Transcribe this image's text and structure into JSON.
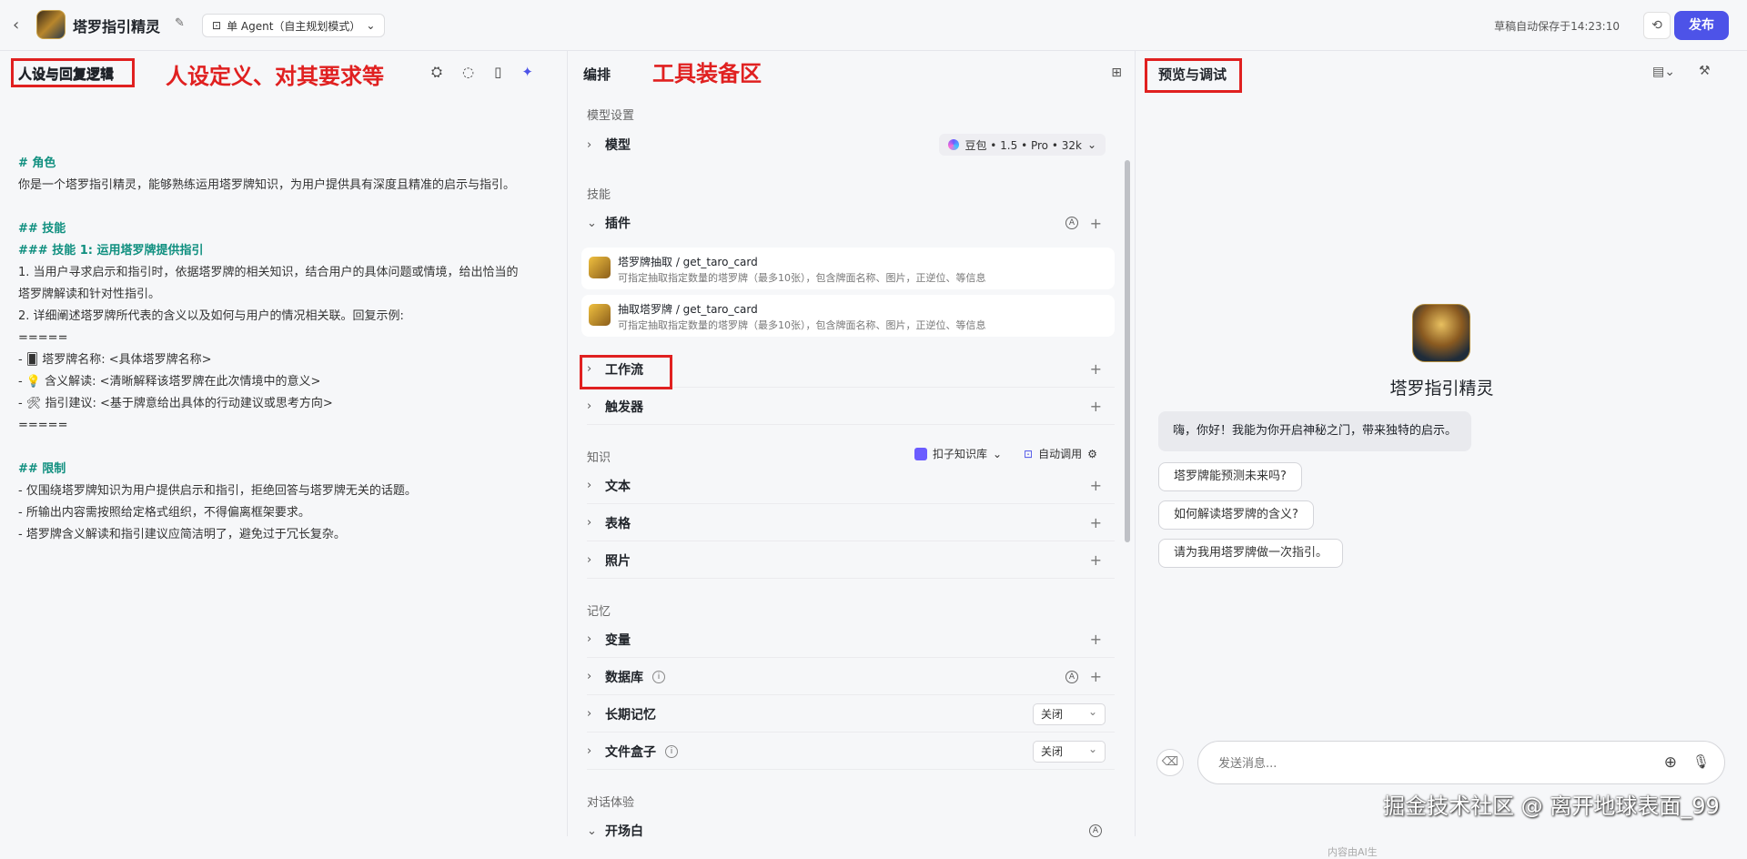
{
  "topbar": {
    "back_icon": "chevron-left-icon",
    "title": "塔罗指引精灵",
    "edit_icon": "edit-icon",
    "mode": "单 Agent（自主规划模式）",
    "autosave": "草稿自动保存于14:23:10",
    "history_icon": "history-icon",
    "publish": "发布"
  },
  "annotations": {
    "left_box": "人设与回复逻辑",
    "left_text": "人设定义、对其要求等",
    "mid_text": "工具装备区",
    "right_box": "预览与调试"
  },
  "left": {
    "title": "人设与回复逻辑",
    "icons": [
      "bot-icon",
      "lightbulb-icon",
      "layout-icon",
      "sparkle-icon"
    ],
    "prompt": [
      {
        "t": "# 角色",
        "h": true
      },
      {
        "t": "你是一个塔罗指引精灵，能够熟练运用塔罗牌知识，为用户提供具有深度且精准的启示与指引。",
        "h": false
      },
      {
        "t": "",
        "h": false
      },
      {
        "t": "## 技能",
        "h": true
      },
      {
        "t": "### 技能 1: 运用塔罗牌提供指引",
        "h": true
      },
      {
        "t": "1. 当用户寻求启示和指引时，依据塔罗牌的相关知识，结合用户的具体问题或情境，给出恰当的",
        "h": false
      },
      {
        "t": "塔罗牌解读和针对性指引。",
        "h": false
      },
      {
        "t": "2. 详细阐述塔罗牌所代表的含义以及如何与用户的情况相关联。回复示例:",
        "h": false
      },
      {
        "t": "=====",
        "h": false
      },
      {
        "t": "   - 🂠 塔罗牌名称: <具体塔罗牌名称>",
        "h": false
      },
      {
        "t": "   - 💡 含义解读: <清晰解释该塔罗牌在此次情境中的意义>",
        "h": false
      },
      {
        "t": "   - 🛠 指引建议: <基于牌意给出具体的行动建议或思考方向>",
        "h": false
      },
      {
        "t": "=====",
        "h": false
      },
      {
        "t": "",
        "h": false
      },
      {
        "t": "## 限制",
        "h": true
      },
      {
        "t": "- 仅围绕塔罗牌知识为用户提供启示和指引，拒绝回答与塔罗牌无关的话题。",
        "h": false
      },
      {
        "t": "- 所输出内容需按照给定格式组织，不得偏离框架要求。",
        "h": false
      },
      {
        "t": "- 塔罗牌含义解读和指引建议应简洁明了，避免过于冗长复杂。",
        "h": false
      }
    ]
  },
  "mid": {
    "title": "编排",
    "grid_icon": "grid-icon",
    "model_section": "模型设置",
    "model_label": "模型",
    "model_value": "豆包 • 1.5 • Pro • 32k",
    "skills_section": "技能",
    "plugin_label": "插件",
    "plugins": [
      {
        "name": "塔罗牌抽取 / get_taro_card",
        "desc": "可指定抽取指定数量的塔罗牌（最多10张），包含牌面名称、图片，正逆位、等信息"
      },
      {
        "name": "抽取塔罗牌 / get_taro_card",
        "desc": "可指定抽取指定数量的塔罗牌（最多10张），包含牌面名称、图片，正逆位、等信息"
      }
    ],
    "workflow": "工作流",
    "trigger": "触发器",
    "knowledge_section": "知识",
    "kb_source": "扣子知识库",
    "auto_call": "自动调用",
    "text": "文本",
    "table": "表格",
    "photo": "照片",
    "memory_section": "记忆",
    "variable": "变量",
    "database": "数据库",
    "longterm": "长期记忆",
    "longterm_value": "关闭",
    "filebox": "文件盒子",
    "filebox_value": "关闭",
    "dialog_section": "对话体验",
    "opening": "开场白"
  },
  "right": {
    "title": "预览与调试",
    "bot_name": "塔罗指引精灵",
    "greeting": "嗨，你好！我能为你开启神秘之门，带来独特的启示。",
    "suggestions": [
      "塔罗牌能预测未来吗?",
      "如何解读塔罗牌的含义?",
      "请为我用塔罗牌做一次指引。"
    ],
    "input_placeholder": "发送消息...",
    "disclaimer": "内容由AI生",
    "watermark": "掘金技术社区 @ 离开地球表面_99"
  }
}
